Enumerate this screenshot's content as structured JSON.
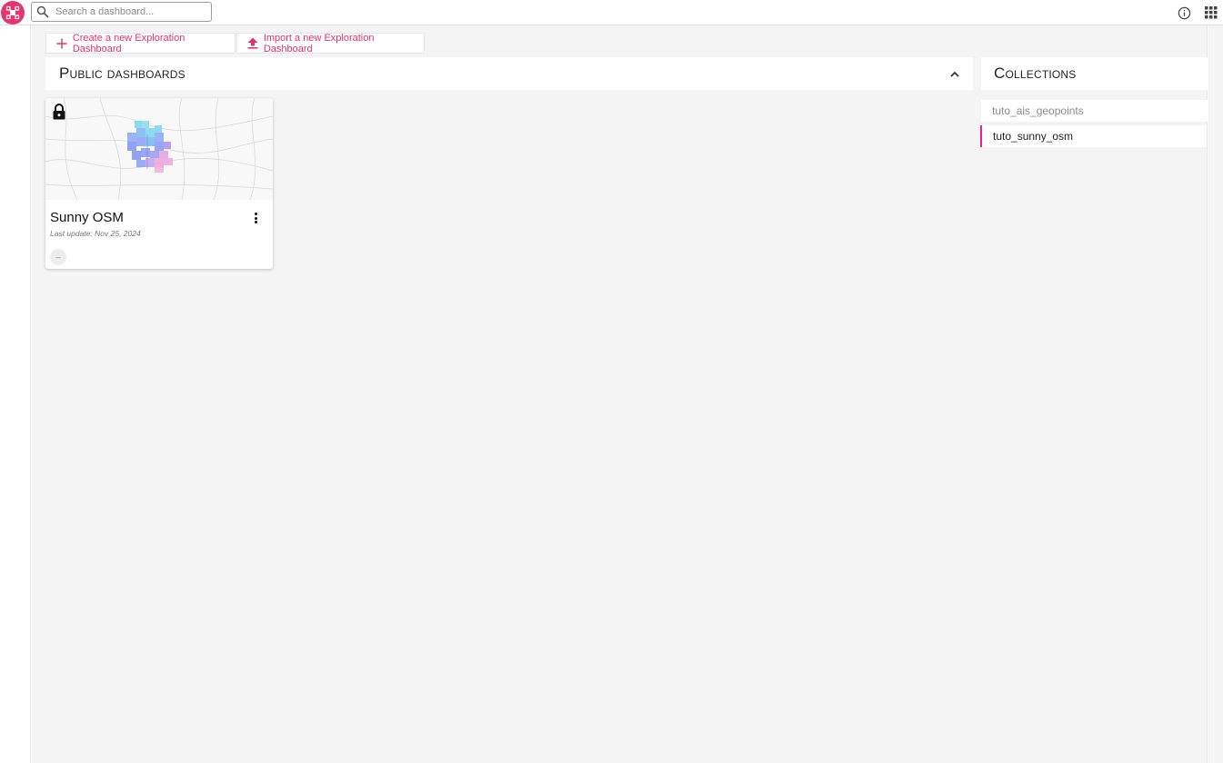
{
  "topbar": {
    "logo_icon": "arlas-logo-icon",
    "search": {
      "placeholder": "Search a dashboard...",
      "value": ""
    },
    "info_icon": "info-circle-icon",
    "apps_icon": "apps-grid-icon"
  },
  "actions": {
    "create_label": "Create a new Exploration Dashboard",
    "create_icon": "plus-icon",
    "import_label": "Import a new Exploration Dashboard",
    "import_icon": "upload-icon"
  },
  "public_dashboards": {
    "title": "Public dashboards",
    "collapse_icon": "chevron-up-icon",
    "cards": [
      {
        "title": "Sunny OSM",
        "last_update": "Last update: Nov 25, 2024",
        "lock_icon": "lock-icon",
        "menu_icon": "more-vert-icon",
        "chip_label": "--"
      }
    ]
  },
  "collections": {
    "title": "Collections",
    "items": [
      {
        "label": "tuto_ais_geopoints",
        "active": false
      },
      {
        "label": "tuto_sunny_osm",
        "active": true
      }
    ]
  },
  "colors": {
    "accent": "#e0356c",
    "logo": "#e8336b",
    "active_indicator": "#e91e9a",
    "background": "#f4f4f4"
  }
}
